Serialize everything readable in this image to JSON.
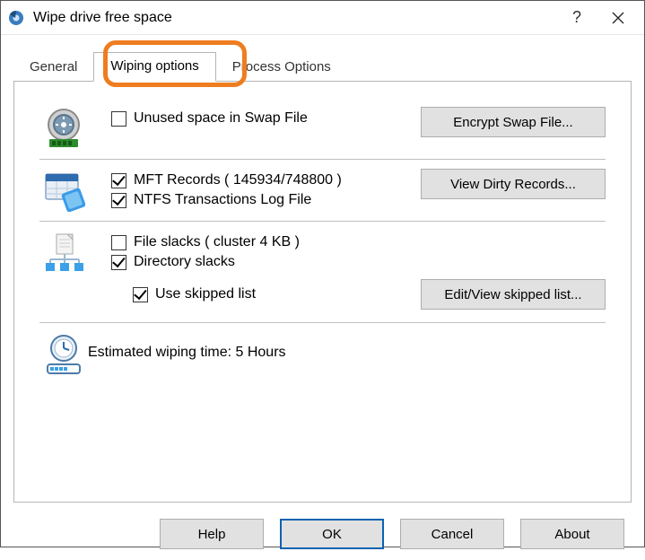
{
  "window": {
    "title": "Wipe drive free space"
  },
  "tabs": {
    "general": "General",
    "wiping": "Wiping options",
    "process": "Process Options"
  },
  "swap": {
    "check_label": "Unused space in Swap File",
    "button": "Encrypt Swap File..."
  },
  "mft": {
    "check_label": "MFT Records (  145934/748800  )",
    "ntfs_label": "NTFS Transactions Log File",
    "button": "View Dirty Records..."
  },
  "slacks": {
    "file_label": "File slacks  ( cluster 4 KB )",
    "dir_label": "Directory slacks",
    "skip_label": "Use skipped list",
    "button": "Edit/View skipped list..."
  },
  "estimate": {
    "label": "Estimated wiping time:   5 Hours"
  },
  "footer": {
    "help": "Help",
    "ok": "OK",
    "cancel": "Cancel",
    "about": "About"
  }
}
